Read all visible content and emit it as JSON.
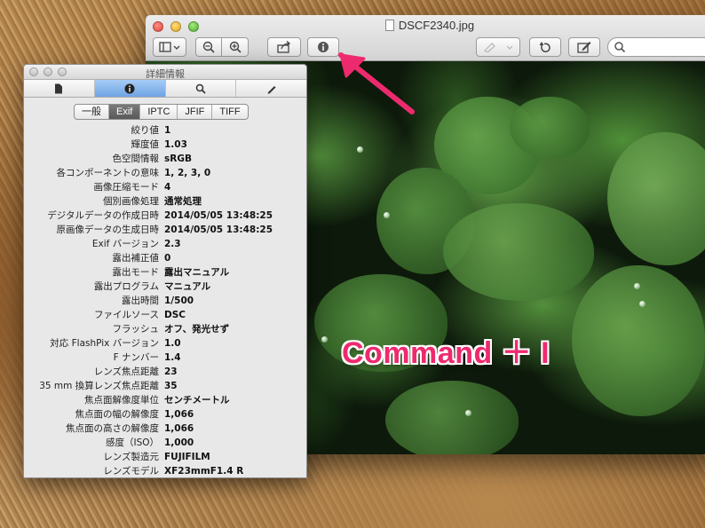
{
  "preview": {
    "title": "DSCF2340.jpg",
    "toolbar": {
      "sidebar_icon": "sidebar-icon",
      "zoom_out_icon": "zoom-out-icon",
      "zoom_in_icon": "zoom-in-icon",
      "share_icon": "share-icon",
      "info_icon": "info-icon",
      "markup_icon": "markup-pen-icon",
      "rotate_icon": "rotate-icon",
      "edit_icon": "edit-icon",
      "search_icon": "search-icon"
    },
    "overlay_text": "Command ＋ I",
    "overlay_color": "#ee2a6e"
  },
  "inspector": {
    "title": "詳細情報",
    "tabs": [
      "document-icon",
      "info-icon",
      "search-icon",
      "pen-icon"
    ],
    "active_tab_index": 1,
    "sub_tabs": [
      "一般",
      "Exif",
      "IPTC",
      "JFIF",
      "TIFF"
    ],
    "active_sub_tab": "Exif",
    "properties": [
      {
        "label": "絞り値",
        "value": "1"
      },
      {
        "label": "輝度値",
        "value": "1.03"
      },
      {
        "label": "色空間情報",
        "value": "sRGB"
      },
      {
        "label": "各コンポーネントの意味",
        "value": "1, 2, 3, 0"
      },
      {
        "label": "画像圧縮モード",
        "value": "4"
      },
      {
        "label": "個別画像処理",
        "value": "通常処理"
      },
      {
        "label": "デジタルデータの作成日時",
        "value": "2014/05/05 13:48:25"
      },
      {
        "label": "原画像データの生成日時",
        "value": "2014/05/05 13:48:25"
      },
      {
        "label": "Exif バージョン",
        "value": "2.3"
      },
      {
        "label": "露出補正値",
        "value": "0"
      },
      {
        "label": "露出モード",
        "value": "露出マニュアル"
      },
      {
        "label": "露出プログラム",
        "value": "マニュアル"
      },
      {
        "label": "露出時間",
        "value": "1/500"
      },
      {
        "label": "ファイルソース",
        "value": "DSC"
      },
      {
        "label": "フラッシュ",
        "value": "オフ、発光せず"
      },
      {
        "label": "対応 FlashPix バージョン",
        "value": "1.0"
      },
      {
        "label": "F ナンバー",
        "value": "1.4"
      },
      {
        "label": "レンズ焦点距離",
        "value": "23"
      },
      {
        "label": "35 mm 換算レンズ焦点距離",
        "value": "35"
      },
      {
        "label": "焦点面解像度単位",
        "value": "センチメートル"
      },
      {
        "label": "焦点面の幅の解像度",
        "value": "1,066"
      },
      {
        "label": "焦点面の高さの解像度",
        "value": "1,066"
      },
      {
        "label": "感度（ISO）",
        "value": "1,000"
      },
      {
        "label": "レンズ製造元",
        "value": "FUJIFILM"
      },
      {
        "label": "レンズモデル",
        "value": "XF23mmF1.4 R"
      }
    ]
  }
}
